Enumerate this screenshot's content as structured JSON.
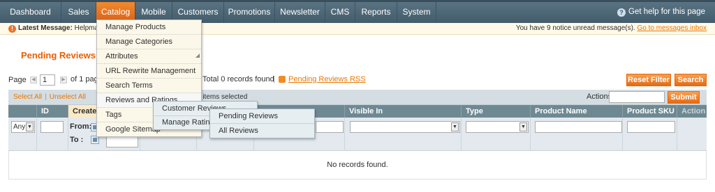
{
  "nav": {
    "items": [
      "Dashboard",
      "Sales",
      "Catalog",
      "Mobile",
      "Customers",
      "Promotions",
      "Newsletter",
      "CMS",
      "Reports",
      "System"
    ],
    "active": "Catalog",
    "help": "Get help for this page"
  },
  "notice": {
    "latest_label": "Latest Message:",
    "latest_text": "Helpmat",
    "unread": "You have 9 notice unread message(s).",
    "link": "Go to messages inbox"
  },
  "page_title": "Pending Reviews",
  "pager": {
    "page_label": "Page",
    "page_value": "1",
    "of_pages": "of 1 pag",
    "total": "Total 0 records found",
    "sep": "|",
    "rss": "Pending Reviews RSS"
  },
  "buttons": {
    "reset": "Reset Filter",
    "search": "Search",
    "submit": "Submit"
  },
  "massaction": {
    "select_all": "Select All",
    "unselect_all": "Unselect All",
    "pipe": "|",
    "selected": "0 items selected",
    "actions_label": "Actions"
  },
  "grid": {
    "columns": [
      "",
      "ID",
      "Create",
      "",
      "",
      "",
      "Visible In",
      "Type",
      "Product Name",
      "Product SKU",
      "Action"
    ],
    "filter": {
      "any": "Any",
      "from": "From:",
      "to": "To :"
    },
    "empty": "No records found."
  },
  "catalog_menu": [
    "Manage Products",
    "Manage Categories",
    "Attributes",
    "URL Rewrite Management",
    "Search Terms",
    "Reviews and Ratings",
    "Tags",
    "Google Sitemap"
  ],
  "reviews_menu": [
    "Customer Reviews",
    "Manage Ratings"
  ],
  "customer_reviews_menu": [
    "Pending Reviews",
    "All Reviews"
  ],
  "icons": {
    "help": "help-icon",
    "warning": "warning-icon",
    "rss": "rss-icon",
    "calendar": "calendar-icon"
  },
  "colors": {
    "nav_bg": "#4f6877",
    "accent": "#eb5e00",
    "grid_header": "#6f8992"
  }
}
